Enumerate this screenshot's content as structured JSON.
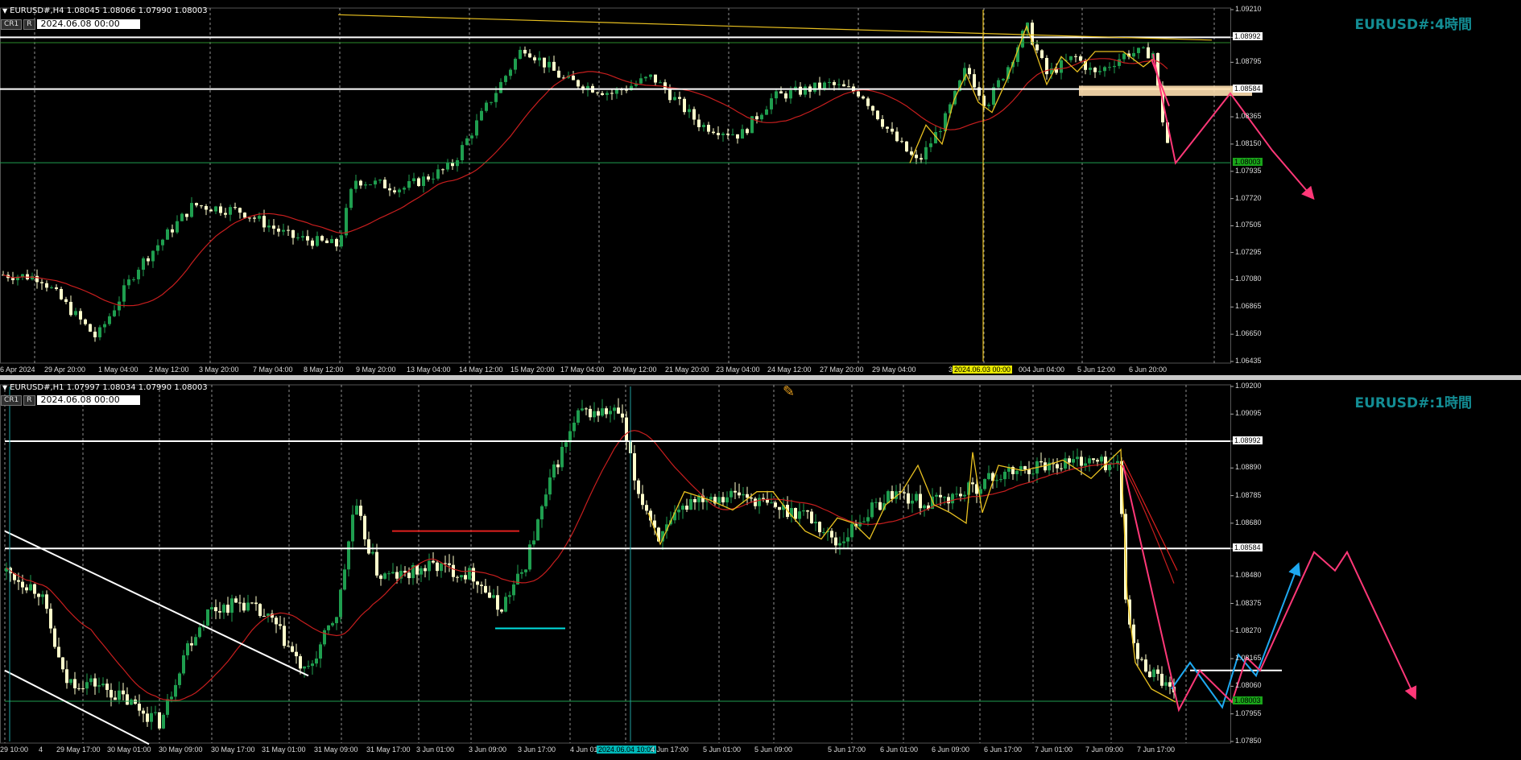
{
  "panes": [
    {
      "id": "h4",
      "header": "EURUSD#,H4  1.08045 1.08066 1.07990 1.08003",
      "title": "EURUSD#:4時間",
      "ctrl_labels": [
        "CR1",
        "R"
      ],
      "date_box": "2024.06.08 00:00",
      "y_labels": [
        "1.09210",
        "1.08992",
        "1.08795",
        "1.08584",
        "1.08365",
        "1.08150",
        "1.07935",
        "1.07720",
        "1.07505",
        "1.07295",
        "1.07080",
        "1.06865",
        "1.06650",
        "1.06435"
      ],
      "y_range": [
        1.06435,
        1.0921
      ],
      "highlight_prices": [
        {
          "label": "1.08992",
          "color": "#ffffff",
          "text": "#000000"
        },
        {
          "label": "1.08584",
          "color": "#ffffff",
          "text": "#000000"
        },
        {
          "label": "1.08003",
          "color": "#1aa51a",
          "text": "#000000"
        }
      ],
      "x_labels": [
        "6 Apr 2024",
        "29 Apr 20:00",
        "1 May 04:00",
        "2 May 12:00",
        "3 May 20:00",
        "7 May 04:00",
        "8 May 12:00",
        "9 May 20:00",
        "13 May 04:00",
        "14 May 12:00",
        "15 May 20:00",
        "17 May 04:00",
        "20 May 12:00",
        "21 May 20:00",
        "23 May 04:00",
        "24 May 12:00",
        "27 May 20:00",
        "29 May 04:00",
        "30 May",
        "2024.06.03 00:00",
        "00",
        "4 Jun 04:00",
        "5 Jun 12:00",
        "6 Jun 20:00"
      ],
      "x_highlight": "2024.06.03 00:00"
    },
    {
      "id": "h1",
      "header": "EURUSD#,H1  1.07997 1.08034 1.07990 1.08003",
      "title": "EURUSD#:1時間",
      "ctrl_labels": [
        "CR1",
        "R"
      ],
      "date_box": "2024.06.08 00:00",
      "y_labels": [
        "1.09200",
        "1.09095",
        "1.08992",
        "1.08890",
        "1.08785",
        "1.08680",
        "1.08584",
        "1.08480",
        "1.08375",
        "1.08270",
        "1.08165",
        "1.08060",
        "1.08003",
        "1.07955",
        "1.07850"
      ],
      "y_range": [
        1.0785,
        1.092
      ],
      "highlight_prices": [
        {
          "label": "1.08992",
          "color": "#ffffff",
          "text": "#000000"
        },
        {
          "label": "1.08584",
          "color": "#ffffff",
          "text": "#000000"
        },
        {
          "label": "1.08003",
          "color": "#1aa51a",
          "text": "#000000"
        }
      ],
      "x_labels": [
        "29 10:00",
        "4",
        "29 May 17:00",
        "30 May 01:00",
        "30 May 09:00",
        "30 May 17:00",
        "31 May 01:00",
        "31 May 09:00",
        "31 May 17:00",
        "3 Jun 01:00",
        "3 Jun 09:00",
        "3 Jun 17:00",
        "4 Jun 01",
        "2024.06.04 10:00",
        "4 Jun 17:00",
        "5 Jun 01:00",
        "5 Jun 09:00",
        "5 Jun 17:00",
        "6 Jun 01:00",
        "6 Jun 09:00",
        "6 Jun 17:00",
        "7 Jun 01:00",
        "7 Jun 09:00",
        "7 Jun 17:00"
      ],
      "x_highlight": "2024.06.04 10:00"
    }
  ],
  "tool_icon": "crosshair-pencil-icon",
  "colors": {
    "bull": "#1f9e4f",
    "bear": "#ffffcc",
    "ma": "#c81e1e",
    "zigzag": "#e8c020",
    "projection_pink": "#ff3878",
    "projection_blue": "#1ea8f0",
    "support_box": "#ffe0b0",
    "level_line": "#ffffff",
    "cyan": "#00e0e0",
    "red_line": "#e0201e",
    "title": "#138d94"
  }
}
